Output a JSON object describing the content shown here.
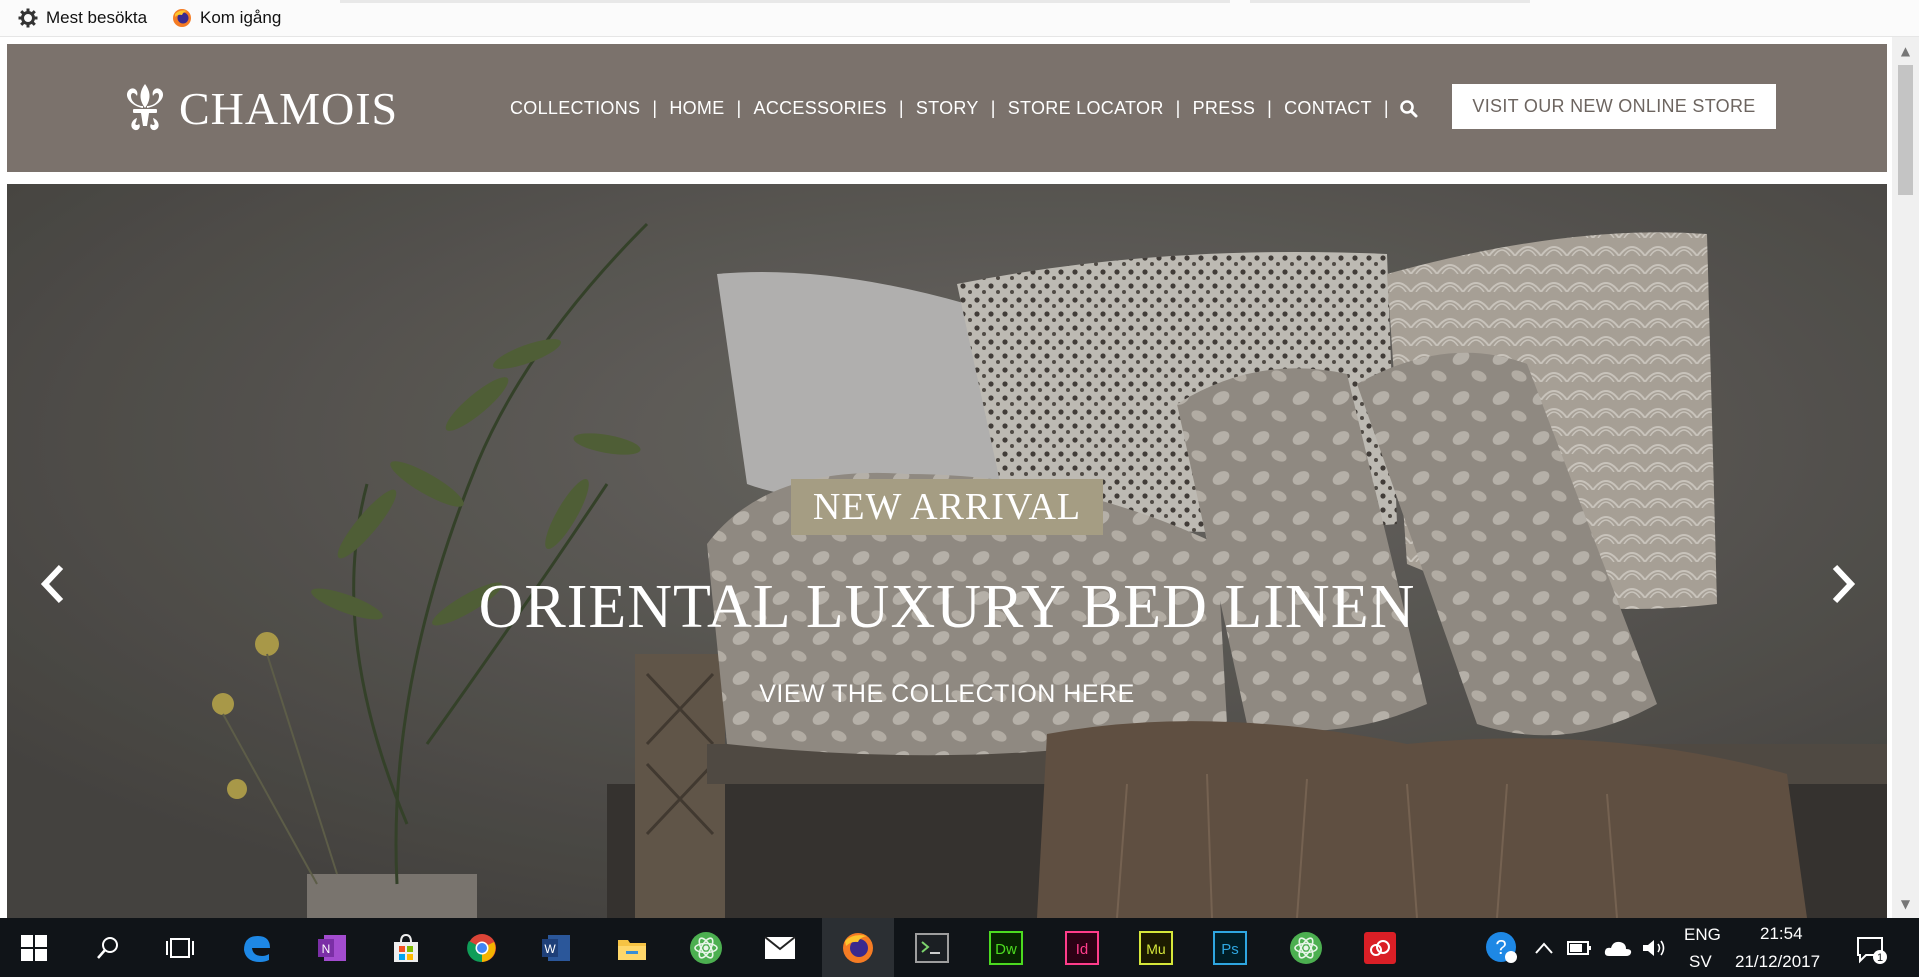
{
  "bookmarks": {
    "items": [
      {
        "label": "Mest besökta",
        "icon": "gear-icon"
      },
      {
        "label": "Kom igång",
        "icon": "firefox-icon"
      }
    ]
  },
  "site": {
    "logo_text": "CHAMOIS",
    "nav": [
      "COLLECTIONS",
      "HOME",
      "ACCESSORIES",
      "STORY",
      "STORE LOCATOR",
      "PRESS",
      "CONTACT"
    ],
    "search_icon": "search-icon",
    "cta_label": "VISIT OUR NEW ONLINE STORE",
    "colors": {
      "header_bg": "#7b726c",
      "badge_bg": "#a59d83"
    }
  },
  "hero": {
    "badge": "NEW ARRIVAL",
    "headline": "ORIENTAL LUXURY BED LINEN",
    "subline": "VIEW THE COLLECTION HERE",
    "prev_icon": "chevron-left-icon",
    "next_icon": "chevron-right-icon"
  },
  "taskbar": {
    "apps": [
      "windows-start",
      "search",
      "task-view",
      "edge",
      "onenote",
      "store",
      "chrome",
      "word",
      "file-explorer",
      "atom",
      "mail",
      "firefox",
      "terminal",
      "dreamweaver",
      "indesign",
      "muse",
      "photoshop",
      "atom-2",
      "creative-cloud"
    ],
    "app_labels": {
      "dreamweaver": "Dw",
      "indesign": "Id",
      "muse": "Mu",
      "photoshop": "Ps"
    },
    "lang_top": "ENG",
    "lang_bottom": "SV",
    "time": "21:54",
    "date": "21/12/2017",
    "notification_count": "1"
  }
}
